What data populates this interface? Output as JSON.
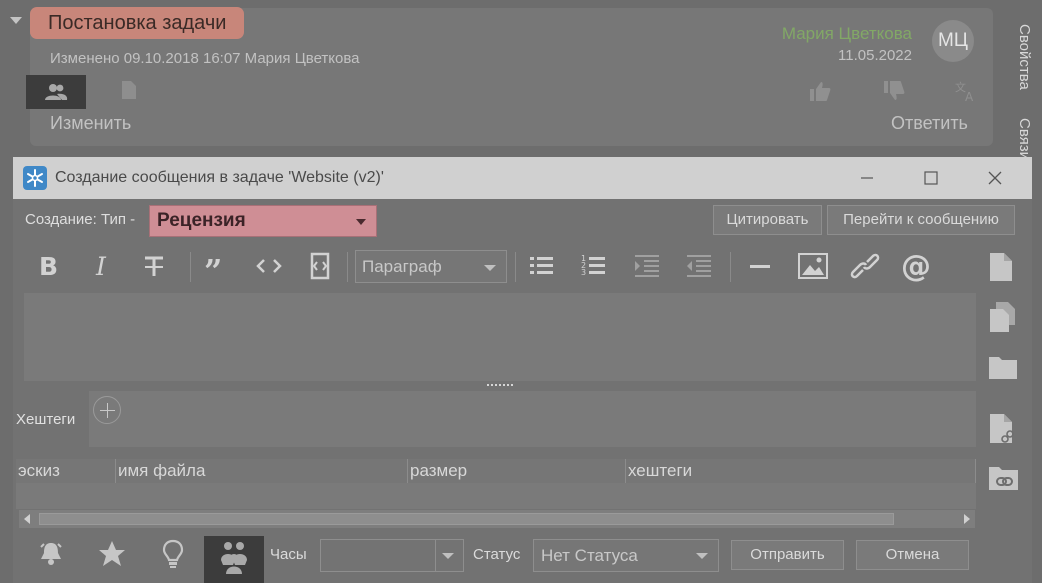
{
  "task": {
    "title": "Постановка задачи",
    "changed_info": "Изменено 09.10.2018 16:07   Мария Цветкова",
    "author": "Мария Цветкова",
    "date": "11.05.2022",
    "avatar_initials": "МЦ",
    "edit_label": "Изменить",
    "reply_label": "Ответить"
  },
  "side_panel": {
    "properties_label": "Свойства",
    "links_label": "Связи"
  },
  "dialog": {
    "title": "Создание сообщения в задаче 'Website (v2)'",
    "type_label": "Создание: Тип -",
    "type_value": "Рецензия",
    "quote_button": "Цитировать",
    "goto_button": "Перейти к сообщению",
    "paragraph_select": "Параграф",
    "hashtags_label": "Хештеги",
    "columns": [
      "эскиз",
      "имя файла",
      "размер",
      "хештеги"
    ],
    "hours_label": "Часы",
    "hours_value": "",
    "status_label": "Статус",
    "status_value": "Нет Статуса",
    "send_button": "Отправить",
    "cancel_button": "Отмена"
  },
  "colors": {
    "task_title_bg": "#c8867a",
    "type_select_bg": "#cf8e95",
    "author_green": "#82a866",
    "app_icon_blue": "#3f88c7"
  },
  "icons": {
    "toolbar": [
      "bold-icon",
      "italic-icon",
      "strikethrough-icon",
      "quote-icon",
      "code-icon",
      "code-block-icon",
      "bullet-list-icon",
      "numbered-list-icon",
      "indent-icon",
      "outdent-icon",
      "horizontal-rule-icon",
      "image-icon",
      "link-icon",
      "mention-icon"
    ],
    "side": [
      "file-icon",
      "copy-files-icon",
      "folder-icon",
      "file-link-icon",
      "folder-link-icon"
    ],
    "footer": [
      "bell-icon",
      "star-icon",
      "lightbulb-icon",
      "persons-icon"
    ]
  }
}
